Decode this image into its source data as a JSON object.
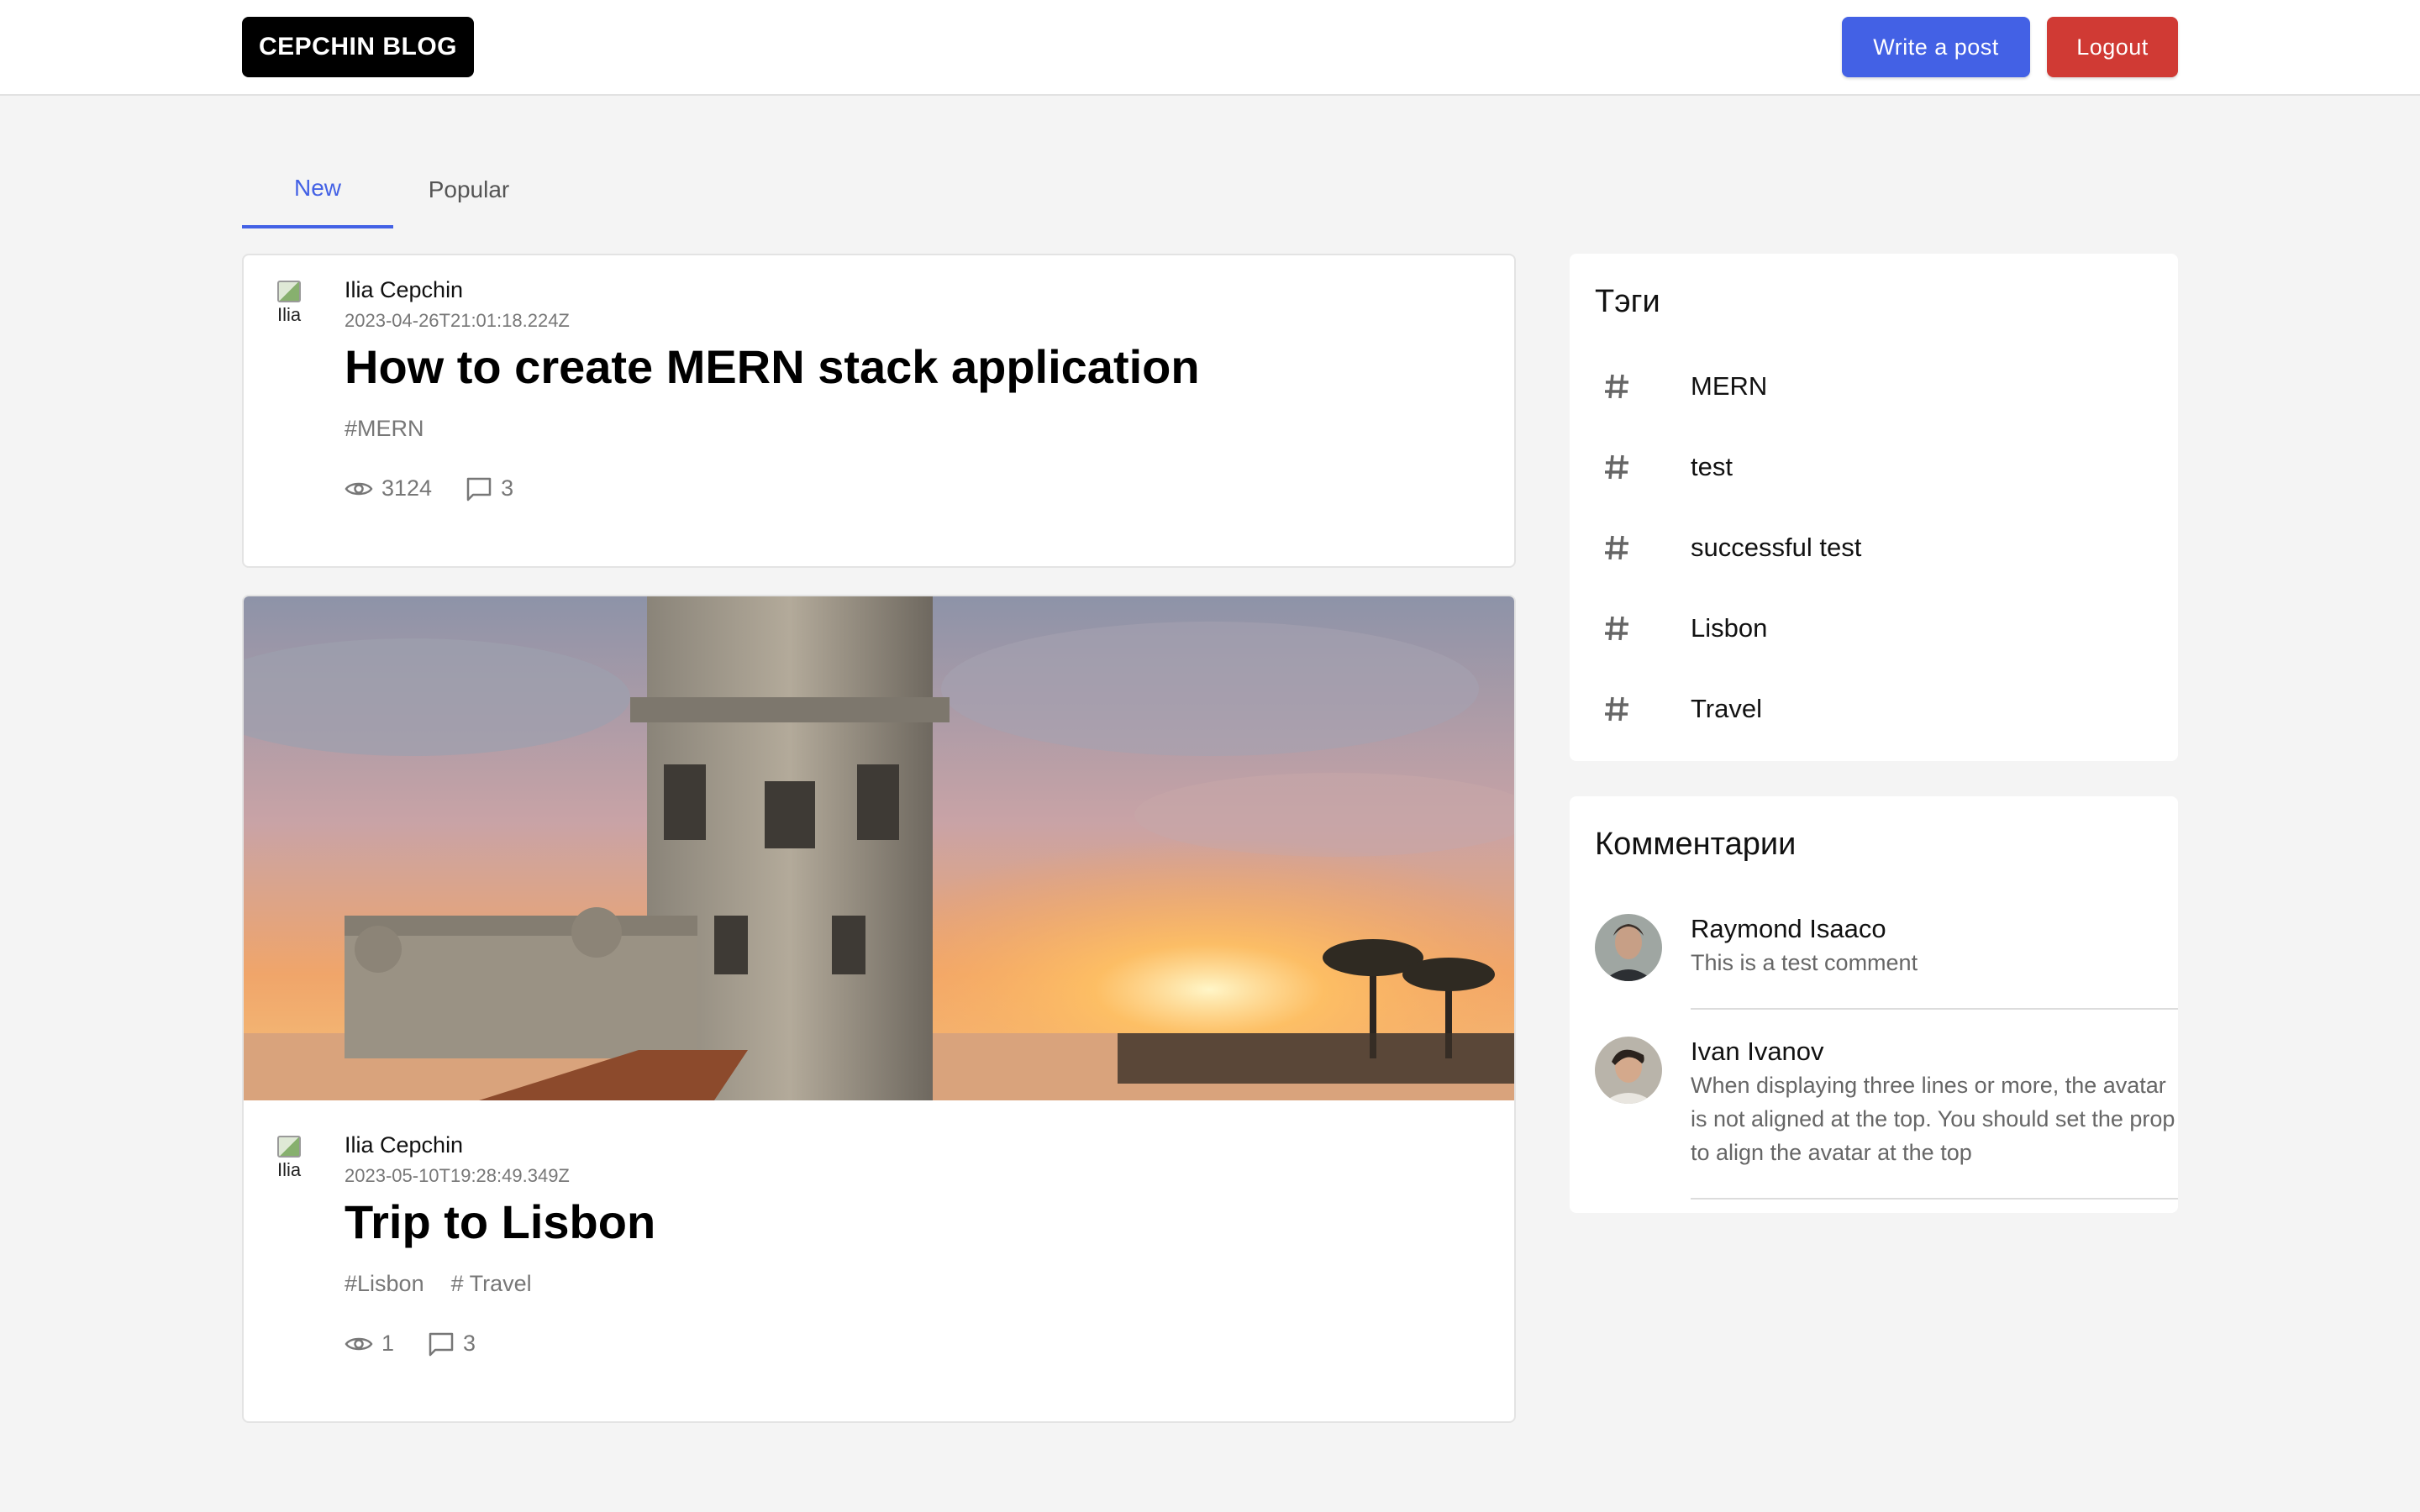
{
  "header": {
    "logo": "CEPCHIN BLOG",
    "write_label": "Write a post",
    "logout_label": "Logout",
    "write_color": "#4361e5",
    "logout_color": "#d03a34"
  },
  "tabs": [
    {
      "label": "New",
      "active": true
    },
    {
      "label": "Popular",
      "active": false
    }
  ],
  "posts": [
    {
      "author": "Ilia Cepchin",
      "avatar_alt": "Ilia",
      "date": "2023-04-26T21:01:18.224Z",
      "title": "How to create MERN stack application",
      "tags": [
        "#MERN"
      ],
      "views": "3124",
      "comments": "3",
      "has_image": false
    },
    {
      "author": "Ilia Cepchin",
      "avatar_alt": "Ilia",
      "date": "2023-05-10T19:28:49.349Z",
      "title": "Trip to Lisbon",
      "tags": [
        "#Lisbon",
        "# Travel"
      ],
      "views": "1",
      "comments": "3",
      "has_image": true
    }
  ],
  "tags_panel": {
    "title": "Тэги",
    "items": [
      "MERN",
      "test",
      "successful test",
      "Lisbon",
      "Travel"
    ]
  },
  "comments_panel": {
    "title": "Комментарии",
    "items": [
      {
        "name": "Raymond Isaaco",
        "text": "This is a test comment"
      },
      {
        "name": "Ivan Ivanov",
        "text": "When displaying three lines or more, the avatar is not aligned at the top. You should set the prop to align the avatar at the top"
      }
    ]
  },
  "icons": {
    "views": "eye-icon",
    "comments": "comment-bubble-icon",
    "tag": "hash-icon"
  }
}
